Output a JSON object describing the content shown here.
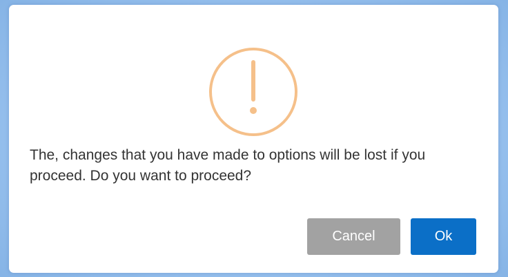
{
  "dialog": {
    "icon": "warning-exclamation-icon",
    "icon_color": "#f5c08a",
    "message": "The, changes that you have made to options will be lost if you proceed. Do you want to proceed?",
    "buttons": {
      "cancel_label": "Cancel",
      "ok_label": "Ok"
    },
    "colors": {
      "cancel_bg": "#a2a2a2",
      "ok_bg": "#0b6fc7"
    }
  }
}
